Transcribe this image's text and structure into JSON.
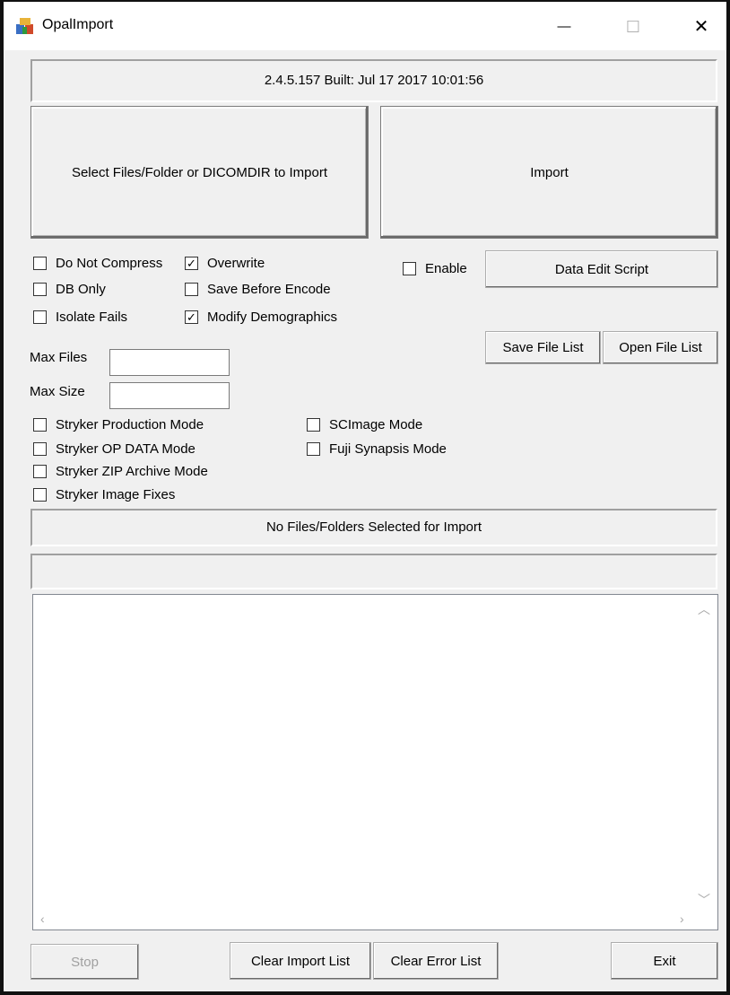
{
  "window": {
    "title": "OpalImport",
    "minimize": "—",
    "maximize": "☐",
    "close": "✕"
  },
  "version_text": "2.4.5.157  Built: Jul 17 2017 10:01:56",
  "select_button": "Select Files/Folder or DICOMDIR to Import",
  "import_button": "Import",
  "options": {
    "do_not_compress": {
      "label": "Do Not Compress",
      "checked": false
    },
    "overwrite": {
      "label": "Overwrite",
      "checked": true
    },
    "db_only": {
      "label": "DB Only",
      "checked": false
    },
    "save_before_encode": {
      "label": "Save Before Encode",
      "checked": false
    },
    "isolate_fails": {
      "label": "Isolate Fails",
      "checked": false
    },
    "modify_demographics": {
      "label": "Modify Demographics",
      "checked": true
    },
    "enable": {
      "label": "Enable",
      "checked": false
    }
  },
  "data_edit_script_button": "Data Edit Script",
  "save_file_list_button": "Save File List",
  "open_file_list_button": "Open File List",
  "max_files": {
    "label": "Max Files",
    "value": ""
  },
  "max_size": {
    "label": "Max Size",
    "value": ""
  },
  "modes": {
    "stryker_production": {
      "label": "Stryker Production Mode",
      "checked": false
    },
    "stryker_op_data": {
      "label": "Stryker OP DATA Mode",
      "checked": false
    },
    "stryker_zip_archive": {
      "label": "Stryker ZIP Archive Mode",
      "checked": false
    },
    "stryker_image_fixes": {
      "label": "Stryker Image Fixes",
      "checked": false
    },
    "scimage": {
      "label": "SCImage Mode",
      "checked": false
    },
    "fuji_synapsis": {
      "label": "Fuji Synapsis Mode",
      "checked": false
    }
  },
  "status_text": "No Files/Folders Selected for Import",
  "progress_text": "",
  "buttons": {
    "stop": "Stop",
    "clear_import_list": "Clear Import List",
    "clear_error_list": "Clear Error List",
    "exit": "Exit"
  },
  "colors": {
    "titlebar": "#ffffff",
    "face": "#f0f0f0",
    "disabled_text": "#a0a0a0"
  }
}
